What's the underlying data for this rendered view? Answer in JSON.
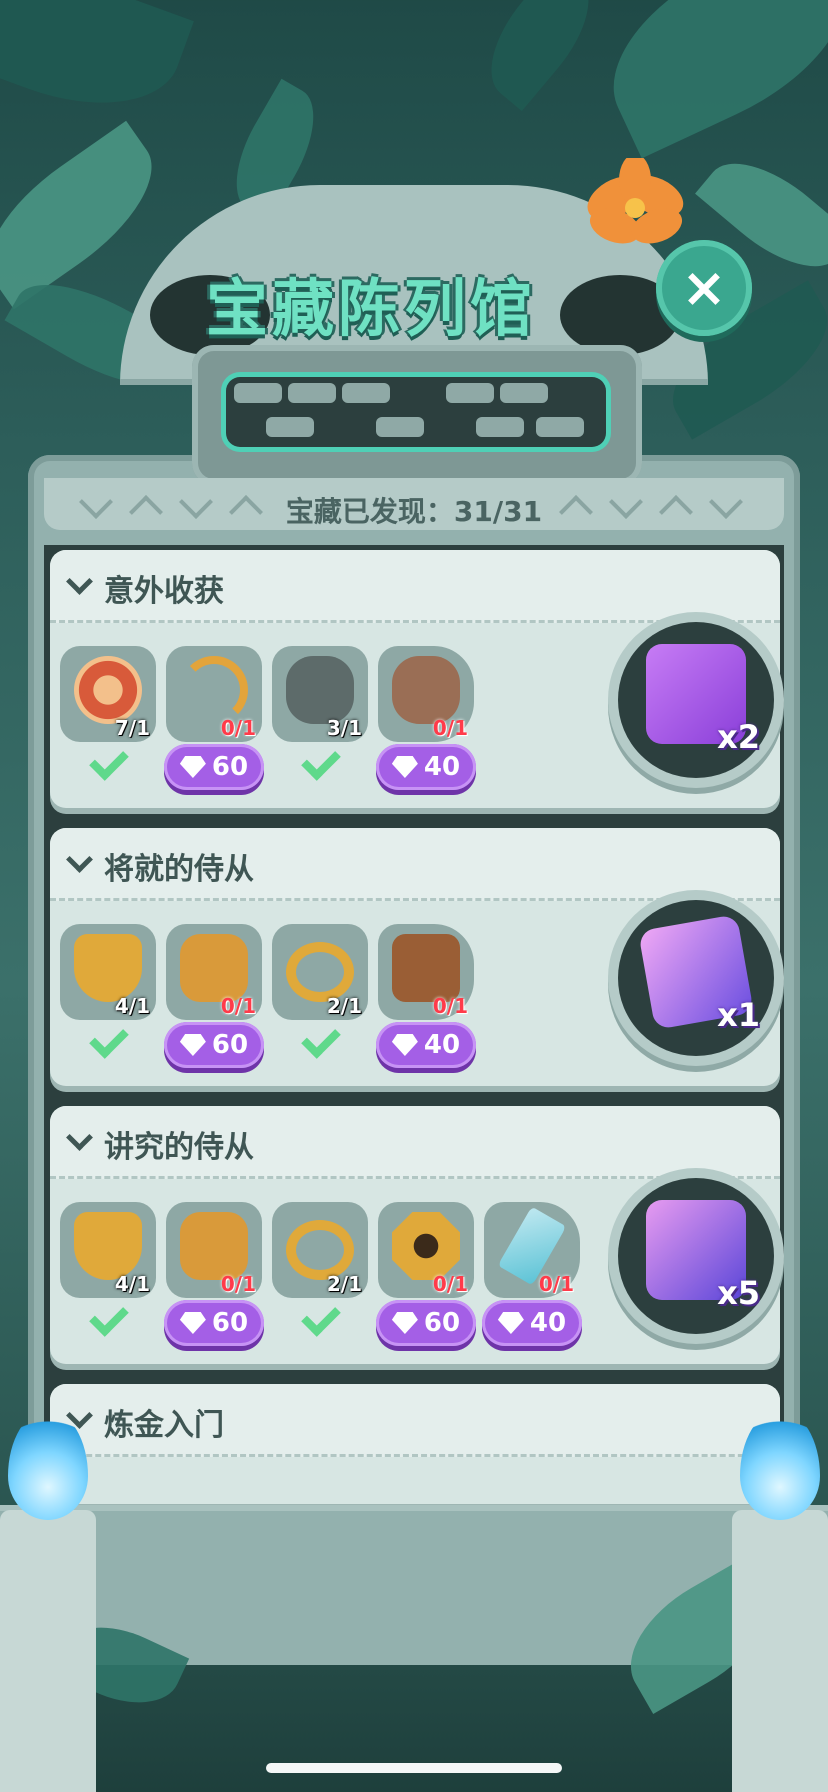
{
  "header": {
    "title": "宝藏陈列馆",
    "close_label": "×",
    "discovered_label": "宝藏已发现：",
    "discovered_value": "31/31"
  },
  "sections": [
    {
      "title": "意外收获",
      "items": [
        {
          "icon": "rocket-target-icon",
          "count": "7/1",
          "owned": true
        },
        {
          "icon": "bow-arrow-icon",
          "count": "0/1",
          "owned": false,
          "price": "60"
        },
        {
          "icon": "stone-serpent-icon",
          "count": "3/1",
          "owned": true
        },
        {
          "icon": "fossil-shell-icon",
          "count": "0/1",
          "owned": false,
          "price": "40"
        }
      ],
      "reward": {
        "icon": "gift-box-icon",
        "multiplier": "x2"
      }
    },
    {
      "title": "将就的侍从",
      "items": [
        {
          "icon": "mickey-shield-icon",
          "count": "4/1",
          "owned": true
        },
        {
          "icon": "chest-armor-icon",
          "count": "0/1",
          "owned": false,
          "price": "60"
        },
        {
          "icon": "gold-belt-icon",
          "count": "2/1",
          "owned": true
        },
        {
          "icon": "wooden-crossbow-icon",
          "count": "0/1",
          "owned": false,
          "price": "40"
        }
      ],
      "reward": {
        "icon": "mickey-card-icon",
        "multiplier": "x1"
      }
    },
    {
      "title": "讲究的侍从",
      "items": [
        {
          "icon": "mickey-shield-icon",
          "count": "4/1",
          "owned": true
        },
        {
          "icon": "chest-armor-icon",
          "count": "0/1",
          "owned": false,
          "price": "60"
        },
        {
          "icon": "gold-belt-icon",
          "count": "2/1",
          "owned": true
        },
        {
          "icon": "mickey-medal-icon",
          "count": "0/1",
          "owned": false,
          "price": "60"
        },
        {
          "icon": "crystal-sword-icon",
          "count": "0/1",
          "owned": false,
          "price": "40"
        }
      ],
      "reward": {
        "icon": "mystery-ticket-icon",
        "multiplier": "x5"
      }
    },
    {
      "title": "炼金入门"
    }
  ],
  "colors": {
    "title_green": "#6fe1c3",
    "gem_purple": "#a45fe6",
    "check_green": "#5fd98b",
    "count_red": "#ff3b4a",
    "stone": "#93b1ae"
  }
}
